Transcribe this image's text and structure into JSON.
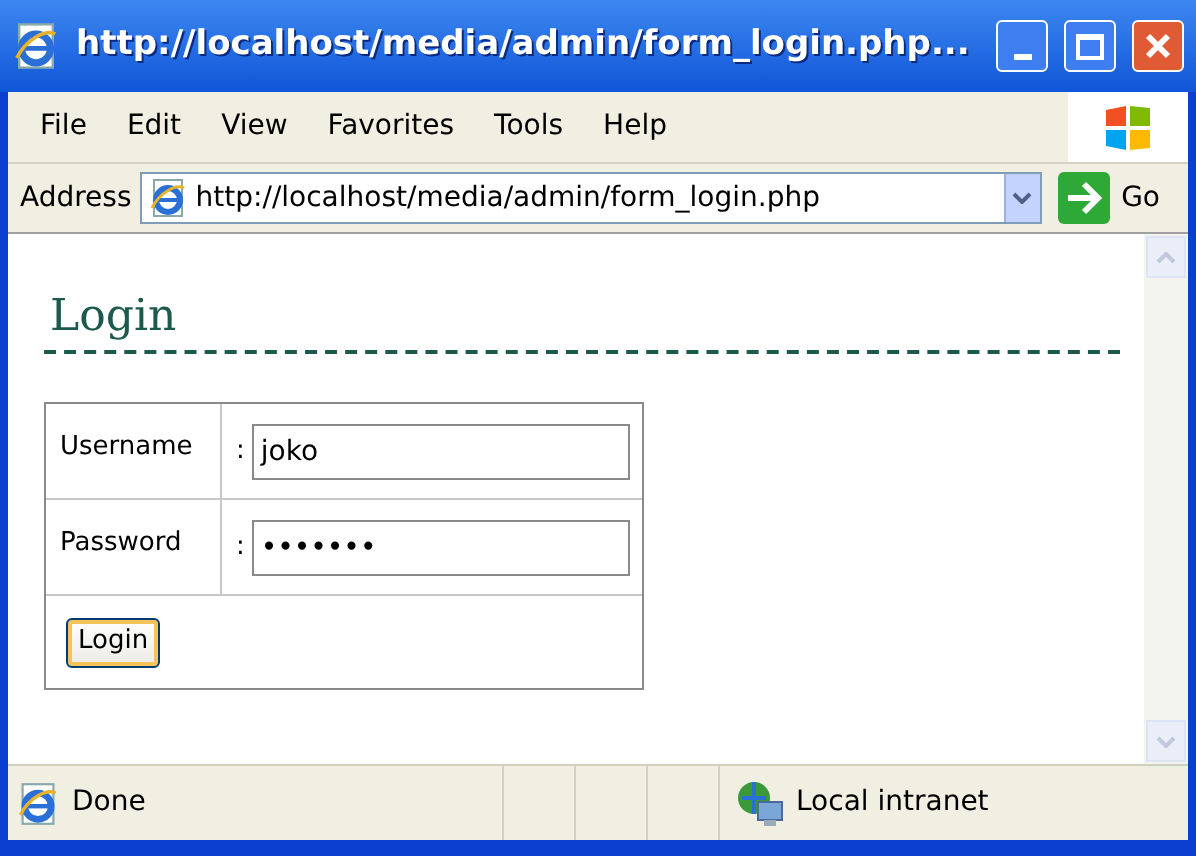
{
  "window": {
    "title": "http://localhost/media/admin/form_login.php..."
  },
  "menu": [
    "File",
    "Edit",
    "View",
    "Favorites",
    "Tools",
    "Help"
  ],
  "address_bar": {
    "label": "Address",
    "value": "http://localhost/media/admin/form_login.php",
    "go": "Go"
  },
  "page": {
    "heading": "Login",
    "form": [
      {
        "label": "Username",
        "separator": ":",
        "value": "joko"
      },
      {
        "label": "Password",
        "separator": ":",
        "value": "•••••••"
      }
    ],
    "button": "Login"
  },
  "status_bar": {
    "text": "Done",
    "zone": "Local intranet"
  }
}
